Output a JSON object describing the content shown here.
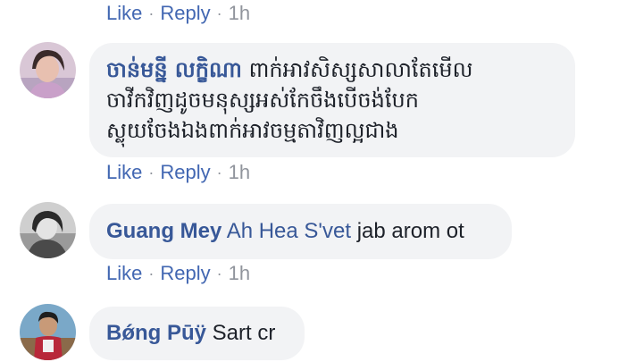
{
  "comments": [
    {
      "author": "ចាន់មន្នី លក្ខិណា",
      "text_lines": [
        "ពាក់អាវសិស្សសាលាតែមើល",
        "ចាវីកវិញដូចមនុស្សអស់កែចឹងបើចង់បែក",
        "ស្លុយចែងឯងពាក់អាវចម្មតាវិញល្អជាង"
      ],
      "actions": {
        "like": "Like",
        "reply": "Reply",
        "time": "1h"
      }
    },
    {
      "author": "Guang Mey",
      "tagged": "Ah Hea S'vet",
      "text": " jab arom ot",
      "actions": {
        "like": "Like",
        "reply": "Reply",
        "time": "1h"
      }
    },
    {
      "author": "Bong Puy",
      "author_display": "Bǿng Pūÿ",
      "text": " Sart cr"
    }
  ],
  "top_actions": {
    "like": "Like",
    "reply": "Reply",
    "time": "1h"
  },
  "separator": "·",
  "colors": {
    "link": "#4267b2",
    "name": "#385898",
    "bubble": "#f2f3f5",
    "meta": "#90949c"
  }
}
